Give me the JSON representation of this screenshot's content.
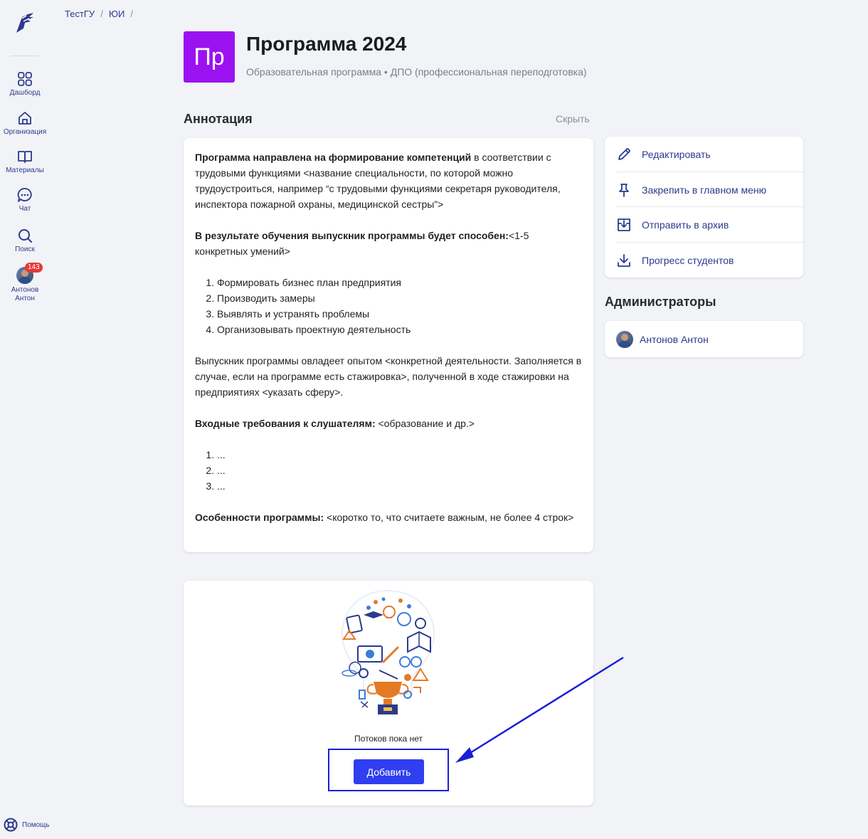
{
  "breadcrumb": [
    "ТестГУ",
    "ЮИ"
  ],
  "sidebar": {
    "items": [
      {
        "label": "Дашборд",
        "icon": "grid-icon"
      },
      {
        "label": "Организация",
        "icon": "home-icon"
      },
      {
        "label": "Материалы",
        "icon": "book-icon"
      },
      {
        "label": "Чат",
        "icon": "chat-icon"
      },
      {
        "label": "Поиск",
        "icon": "search-icon"
      }
    ],
    "user": {
      "first": "Антонов",
      "last": "Антон",
      "badge": "143"
    },
    "help": "Помощь"
  },
  "program": {
    "icon_text": "Пр",
    "title": "Программа 2024",
    "subtitle": "Образовательная программа • ДПО (профессиональная переподготовка)",
    "color": "#9b12f0"
  },
  "annotation": {
    "heading": "Аннотация",
    "hide": "Скрыть",
    "p1_bold": "Программа направлена на формирование компетенций",
    "p1_text": " в соответствии с трудовыми функциями <название специальности, по которой можно трудоустроиться, например “с трудовыми функциями секретаря руководителя, инспектора пожарной охраны, медицинской сестры”>",
    "p2_bold": "В результате обучения выпускник программы будет способен:",
    "p2_text": "<1-5 конкретных умений>",
    "list1": [
      "Формировать бизнес план предприятия",
      "Производить замеры",
      "Выявлять и устранять проблемы",
      "Организовывать проектную деятельность"
    ],
    "p3_text": "Выпускник программы овладеет опытом <конкретной деятельности. Заполняется в случае, если на программе есть стажировка>, полученной в ходе стажировки на предприятиях <указать сферу>.",
    "p4_bold": "Входные требования к слушателям:",
    "p4_text": " <образование и др.>",
    "list2": [
      "...",
      "...",
      "..."
    ],
    "p5_bold": "Особенности программы:",
    "p5_text": " <коротко то, что считаете важным, не более 4 строк>"
  },
  "actions": [
    {
      "label": "Редактировать",
      "icon": "pencil-icon"
    },
    {
      "label": "Закрепить в главном меню",
      "icon": "pin-icon"
    },
    {
      "label": "Отправить в архив",
      "icon": "archive-icon"
    },
    {
      "label": "Прогресс студентов",
      "icon": "download-icon"
    }
  ],
  "admins": {
    "heading": "Администраторы",
    "list": [
      {
        "name": "Антонов Антон"
      }
    ]
  },
  "streams": {
    "empty_text": "Потоков пока нет",
    "add_label": "Добавить"
  },
  "colors": {
    "accent": "#2f3ef0",
    "nav": "#2c3a8c",
    "annotation_arrow": "#1a1fd6"
  }
}
